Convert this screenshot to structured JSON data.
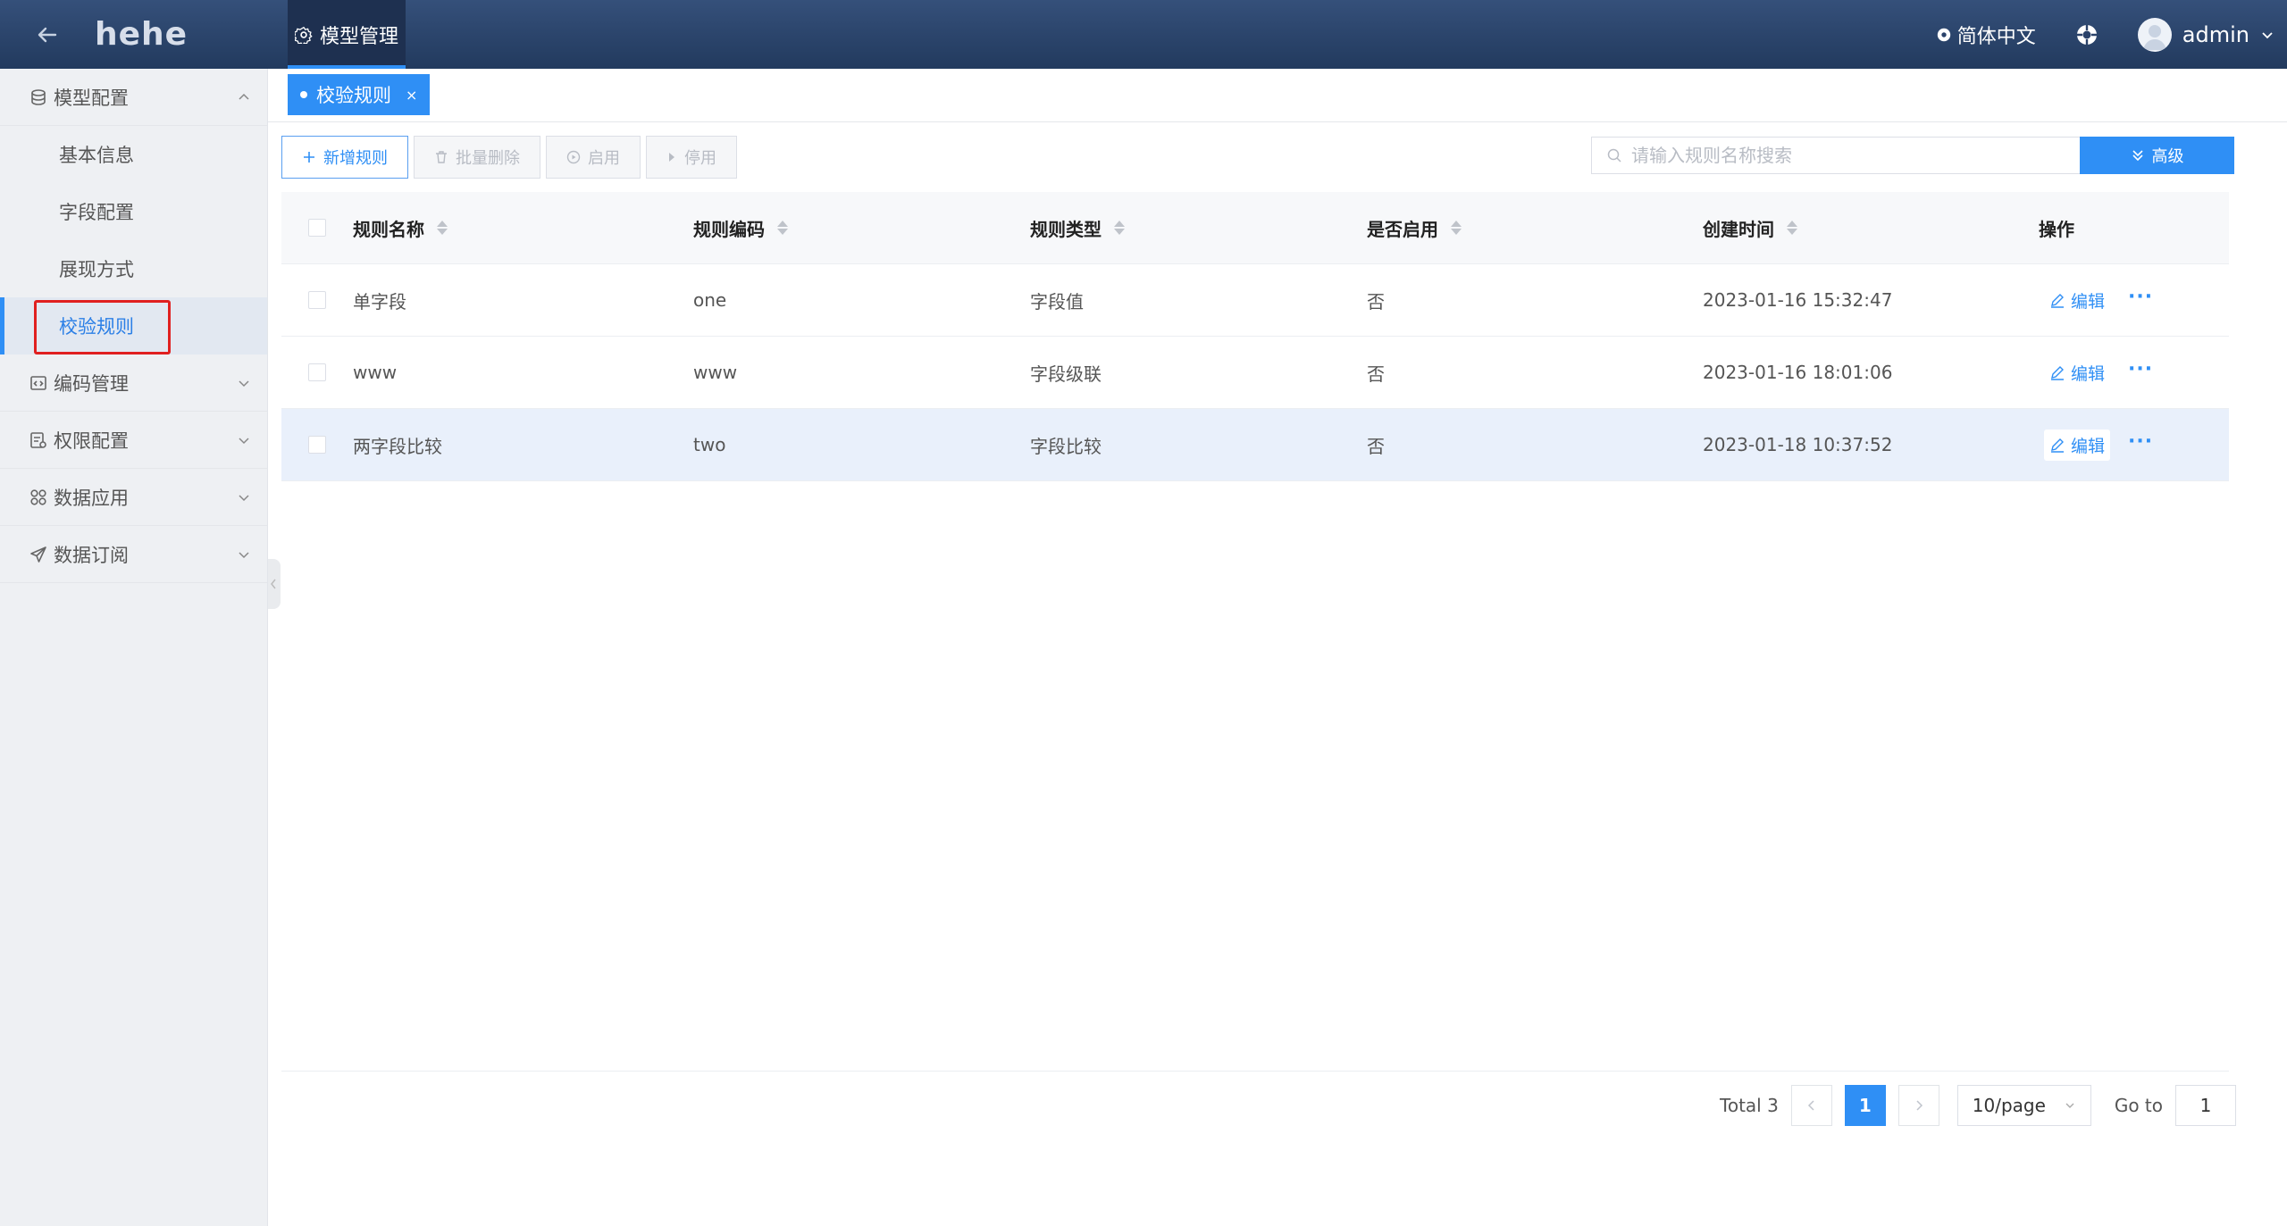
{
  "header": {
    "logo": "hehe",
    "module_tab": "模型管理",
    "language": "简体中文",
    "user": "admin"
  },
  "sidebar": {
    "groups": [
      {
        "label": "模型配置",
        "icon": "database-icon",
        "expanded": true,
        "items": [
          {
            "label": "基本信息"
          },
          {
            "label": "字段配置"
          },
          {
            "label": "展现方式"
          },
          {
            "label": "校验规则",
            "active": true
          }
        ]
      },
      {
        "label": "编码管理",
        "icon": "code-icon"
      },
      {
        "label": "权限配置",
        "icon": "permission-icon"
      },
      {
        "label": "数据应用",
        "icon": "apps-icon"
      },
      {
        "label": "数据订阅",
        "icon": "send-icon"
      }
    ]
  },
  "page_tab": {
    "label": "校验规则",
    "close": "×"
  },
  "toolbar": {
    "add": "新增规则",
    "batch_delete": "批量删除",
    "enable": "启用",
    "disable": "停用",
    "search_placeholder": "请输入规则名称搜索",
    "advanced": "高级"
  },
  "table": {
    "columns": [
      "规则名称",
      "规则编码",
      "规则类型",
      "是否启用",
      "创建时间",
      "操作"
    ],
    "rows": [
      {
        "name": "单字段",
        "code": "one",
        "type": "字段值",
        "enabled": "否",
        "created": "2023-01-16 15:32:47"
      },
      {
        "name": "www",
        "code": "www",
        "type": "字段级联",
        "enabled": "否",
        "created": "2023-01-16 18:01:06"
      },
      {
        "name": "两字段比较",
        "code": "two",
        "type": "字段比较",
        "enabled": "否",
        "created": "2023-01-18 10:37:52"
      }
    ],
    "edit_label": "编辑",
    "more_label": "···"
  },
  "pagination": {
    "total": "Total 3",
    "current_page": "1",
    "page_size": "10/page",
    "goto_label": "Go to",
    "goto_value": "1"
  },
  "colors": {
    "header": "#2a426a",
    "accent": "#2f8ff5",
    "highlight_box": "#e02020"
  }
}
